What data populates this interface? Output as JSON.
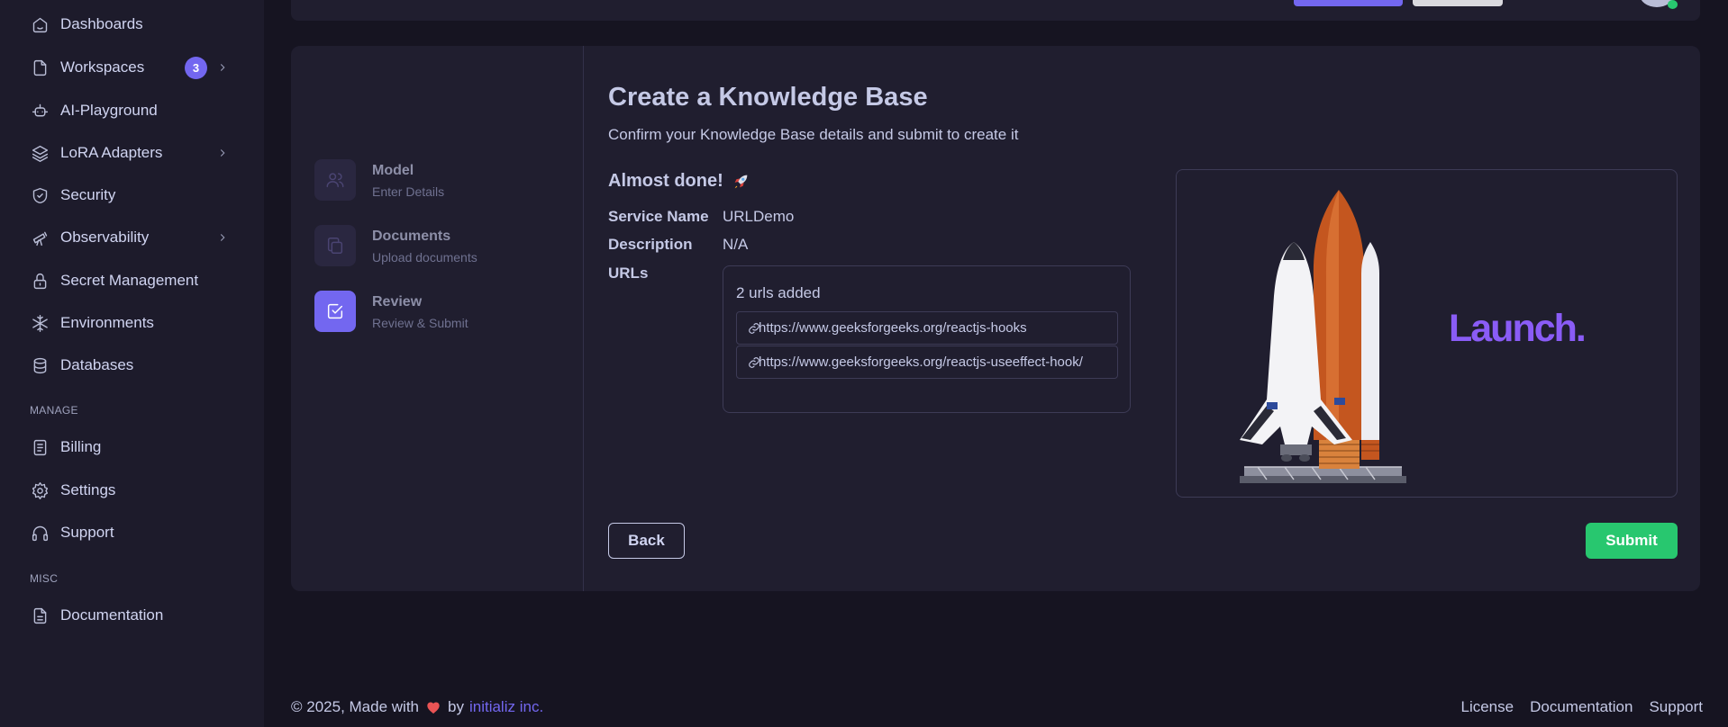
{
  "sidebar": {
    "items": [
      {
        "label": "Dashboards",
        "icon": "home-icon"
      },
      {
        "label": "Workspaces",
        "icon": "file-icon",
        "badge": "3"
      },
      {
        "label": "AI-Playground",
        "icon": "robot-icon"
      },
      {
        "label": "LoRA Adapters",
        "icon": "layers-icon"
      },
      {
        "label": "Security",
        "icon": "shield-check-icon"
      },
      {
        "label": "Observability",
        "icon": "telescope-icon"
      },
      {
        "label": "Secret Management",
        "icon": "lock-icon"
      },
      {
        "label": "Environments",
        "icon": "snowflake-icon"
      },
      {
        "label": "Databases",
        "icon": "database-icon"
      }
    ],
    "manage_title": "MANAGE",
    "manage_items": [
      {
        "label": "Billing",
        "icon": "receipt-icon"
      },
      {
        "label": "Settings",
        "icon": "gear-icon"
      },
      {
        "label": "Support",
        "icon": "headphones-icon"
      }
    ],
    "misc_title": "MISC",
    "misc_items": [
      {
        "label": "Documentation",
        "icon": "document-icon"
      }
    ]
  },
  "stepper": {
    "steps": [
      {
        "title": "Model",
        "subtitle": "Enter Details",
        "icon": "users-icon"
      },
      {
        "title": "Documents",
        "subtitle": "Upload documents",
        "icon": "copy-icon"
      },
      {
        "title": "Review",
        "subtitle": "Review & Submit",
        "icon": "check-square-icon",
        "active": true
      }
    ]
  },
  "main": {
    "title": "Create a Knowledge Base",
    "subtitle": "Confirm your Knowledge Base details and submit to create it",
    "almost_done": "Almost done!",
    "service_name_label": "Service Name",
    "service_name_value": "URLDemo",
    "description_label": "Description",
    "description_value": "N/A",
    "urls_label": "URLs",
    "urls_count": "2 urls added",
    "urls": [
      "https://www.geeksforgeeks.org/reactjs-hooks",
      "https://www.geeksforgeeks.org/reactjs-useeffect-hook/"
    ],
    "launch_text": "Launch.",
    "back_label": "Back",
    "submit_label": "Submit"
  },
  "footer": {
    "copyright": "© 2025, Made with",
    "by": "by",
    "company": "initializ inc.",
    "links": [
      "License",
      "Documentation",
      "Support"
    ]
  },
  "colors": {
    "accent": "#7367f0",
    "success": "#28c76f",
    "launch": "#8a5cf6",
    "background": "#161421"
  }
}
